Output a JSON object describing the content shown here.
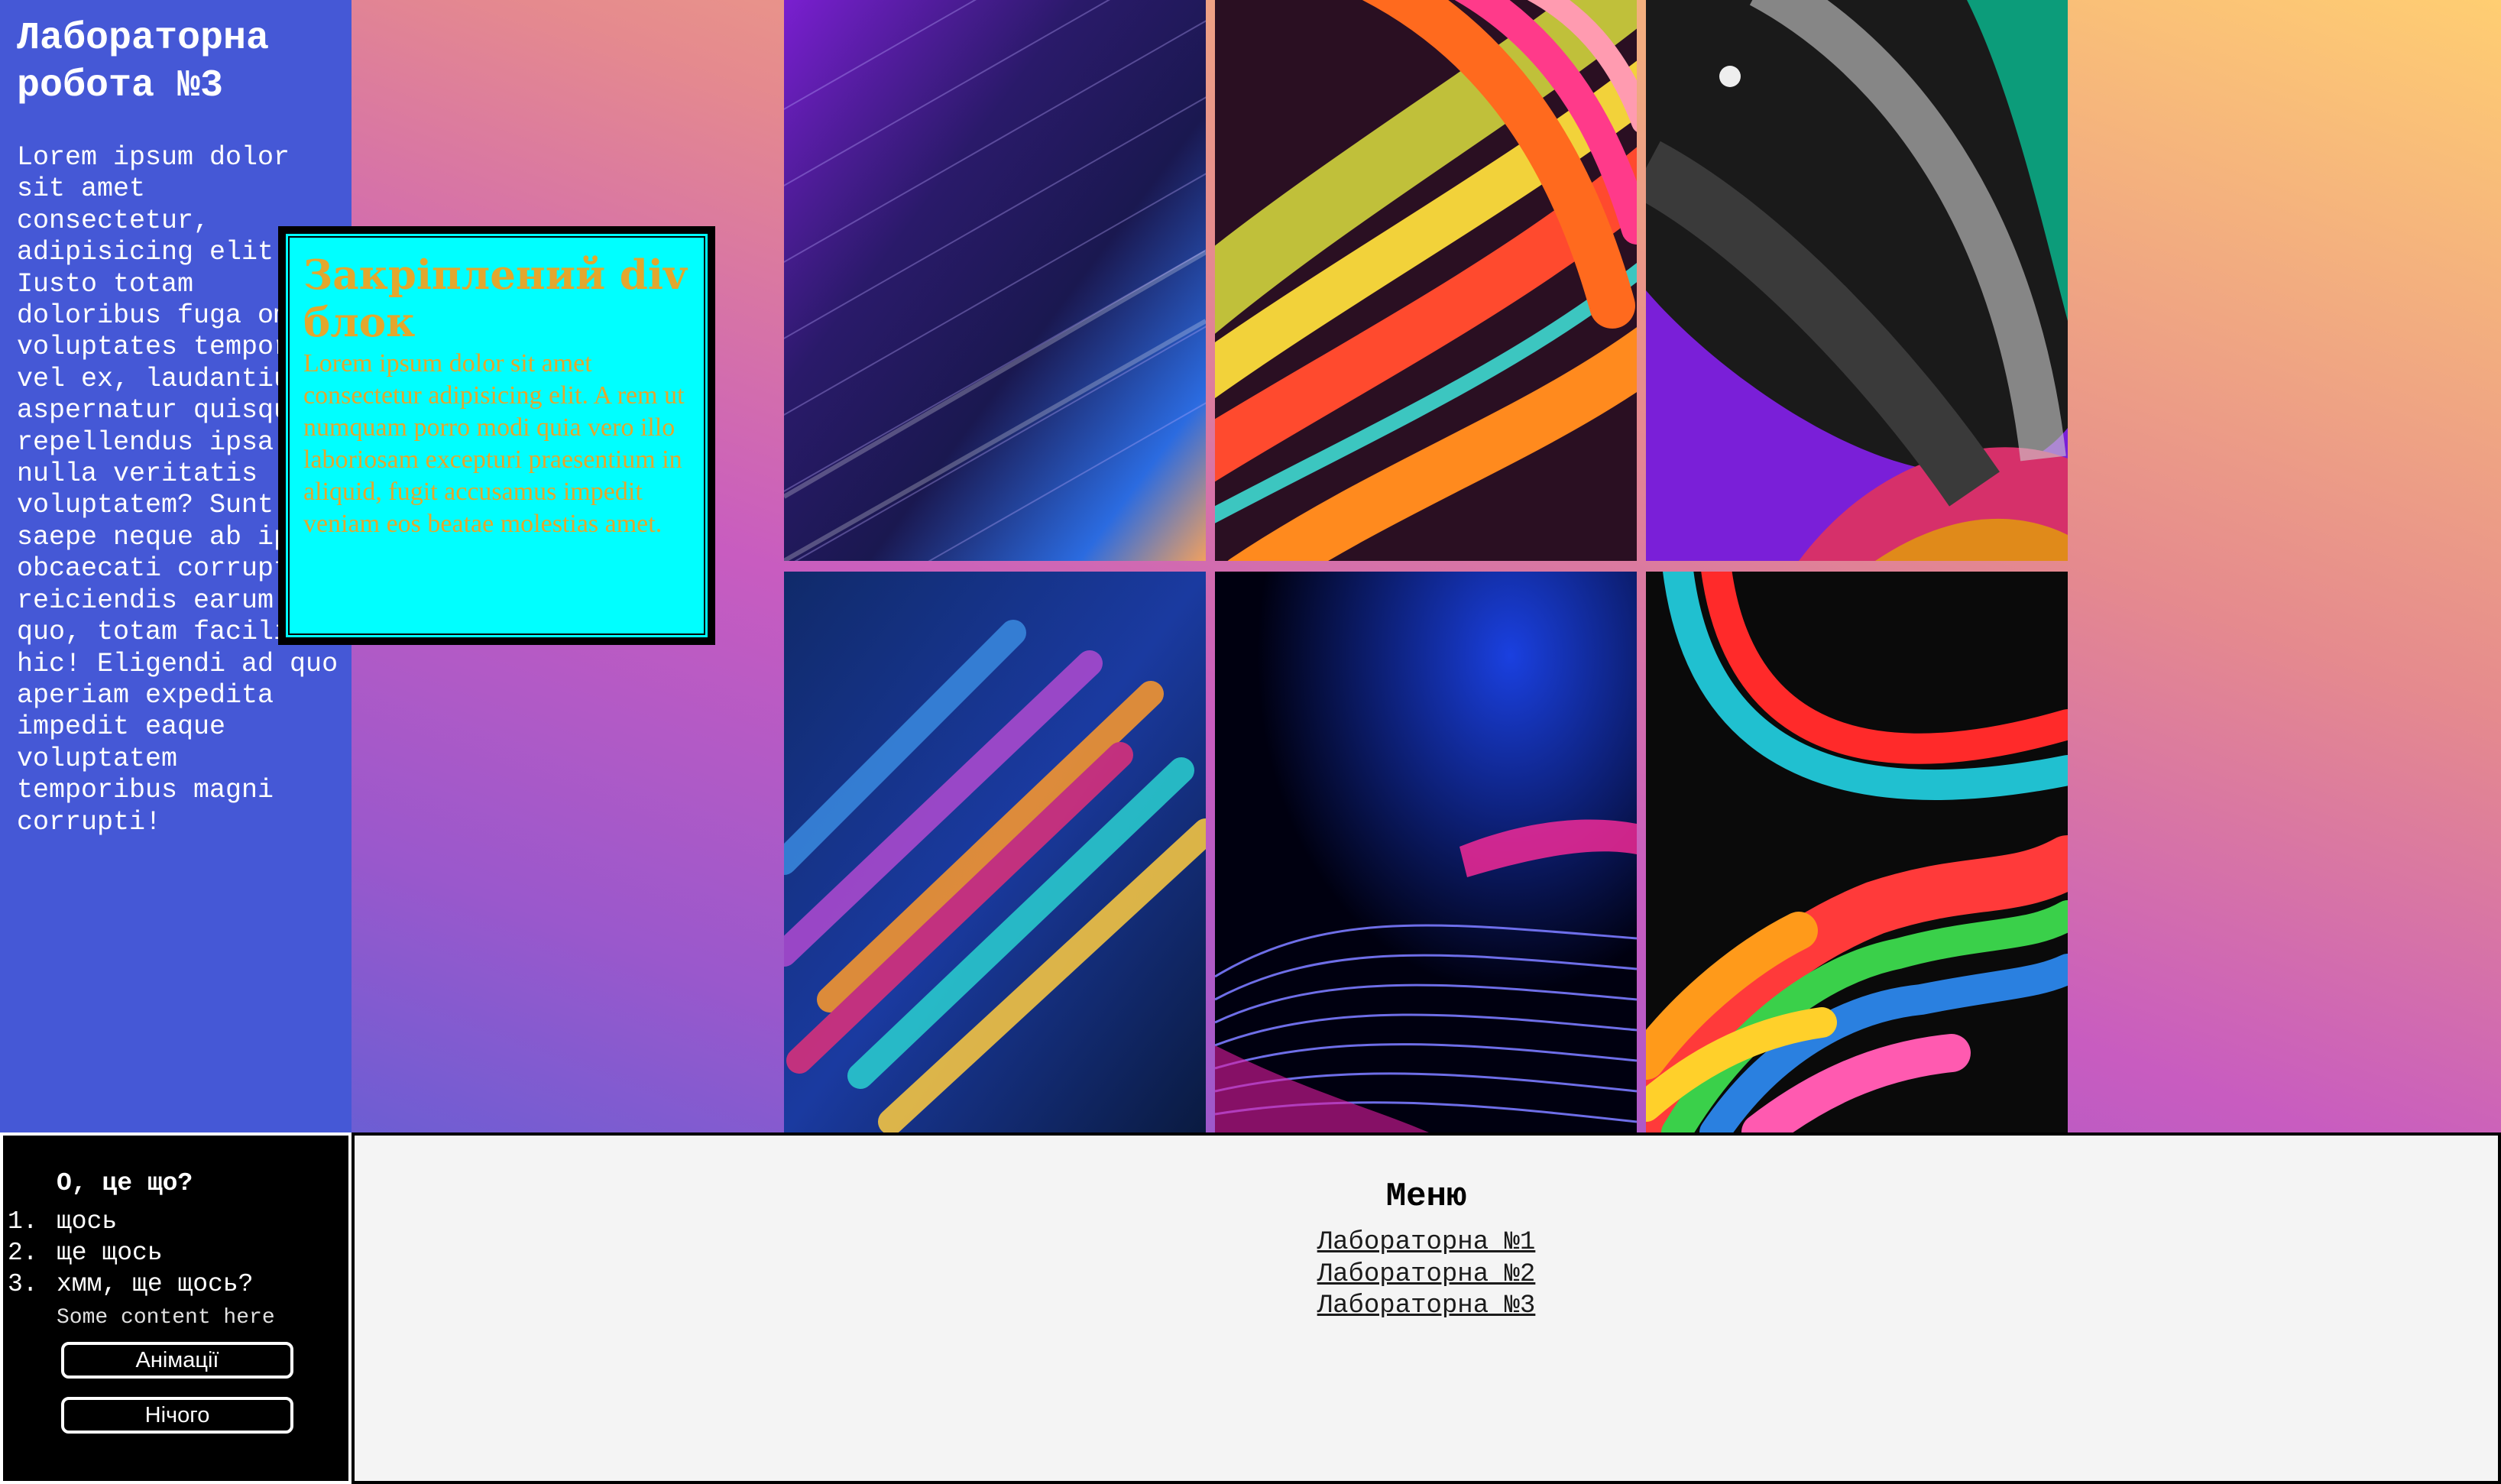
{
  "sidebar": {
    "title": "Лабораторна\nробота №3",
    "text": "Lorem ipsum dolor sit amet consectetur, adipisicing elit. Iusto totam doloribus fuga omnis voluptates tempora vel ex, laudantium aspernatur quisquam repellendus ipsa quo nulla veritatis voluptatem? Sunt saepe neque ab ipsum obcaecati corrupti reiciendis earum quo, totam facilis hic! Eligendi ad quo aperiam expedita impedit eaque voluptatem temporibus magni corrupti!"
  },
  "fixed_block": {
    "title": "Закріплений div блок",
    "text": "Lorem ipsum dolor sit amet consectetur adipisicing elit. A rem ut numquam porro modi quia vero illo laboriosam excepturi praesentium in aliquid, fugit accusamus impedit veniam eos beatae molestias amet."
  },
  "gallery": {
    "images": [
      {
        "icon": "abstract-purple-streaks-image"
      },
      {
        "icon": "abstract-colorful-curves-image"
      },
      {
        "icon": "abstract-dark-arches-image"
      },
      {
        "icon": "abstract-blurred-rainbow-image"
      },
      {
        "icon": "abstract-blue-mesh-waves-image"
      },
      {
        "icon": "abstract-liquid-swirl-image"
      }
    ]
  },
  "info_box": {
    "heading": "О, це що?",
    "items": [
      {
        "num": "1.",
        "text": "щось"
      },
      {
        "num": "2.",
        "text": "ще щось"
      },
      {
        "num": "3.",
        "text": "хмм, ще щось?"
      }
    ],
    "small_text": "Some content here",
    "button_animations": "Анімації",
    "button_nothing": "Нічого"
  },
  "menu": {
    "title": "Меню",
    "links": [
      {
        "label": "Лабораторна №1"
      },
      {
        "label": "Лабораторна №2"
      },
      {
        "label": "Лабораторна №3"
      }
    ]
  },
  "colors": {
    "sidebar_bg": "#4558d6",
    "fixed_block_bg": "#00ffff",
    "fixed_block_text": "#e3a72d",
    "menu_bg": "#f4f4f4"
  }
}
